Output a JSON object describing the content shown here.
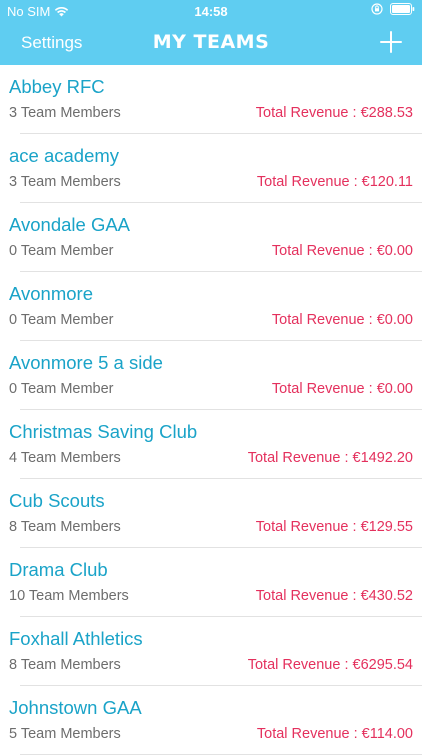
{
  "status_bar": {
    "carrier": "No SIM",
    "time": "14:58"
  },
  "nav": {
    "left_label": "Settings",
    "title": "MY TEAMS",
    "right_icon": "plus-icon"
  },
  "teams": [
    {
      "name": "Abbey RFC",
      "members": "3 Team Members",
      "revenue": "Total Revenue : €288.53"
    },
    {
      "name": "ace academy",
      "members": "3 Team Members",
      "revenue": "Total Revenue : €120.11"
    },
    {
      "name": "Avondale GAA",
      "members": "0 Team Member",
      "revenue": "Total Revenue : €0.00"
    },
    {
      "name": "Avonmore",
      "members": "0 Team Member",
      "revenue": "Total Revenue : €0.00"
    },
    {
      "name": "Avonmore 5 a side",
      "members": "0 Team Member",
      "revenue": "Total Revenue : €0.00"
    },
    {
      "name": "Christmas Saving Club",
      "members": "4 Team Members",
      "revenue": "Total Revenue : €1492.20"
    },
    {
      "name": "Cub Scouts",
      "members": "8 Team Members",
      "revenue": "Total Revenue : €129.55"
    },
    {
      "name": "Drama Club",
      "members": "10 Team Members",
      "revenue": "Total Revenue : €430.52"
    },
    {
      "name": "Foxhall Athletics",
      "members": "8 Team Members",
      "revenue": "Total Revenue : €6295.54"
    },
    {
      "name": "Johnstown GAA",
      "members": "5 Team Members",
      "revenue": "Total Revenue : €114.00"
    }
  ],
  "colors": {
    "header_bg": "#5fcdf1",
    "team_name": "#1aa3c8",
    "revenue": "#e4305d",
    "members": "#6d6d6d"
  }
}
